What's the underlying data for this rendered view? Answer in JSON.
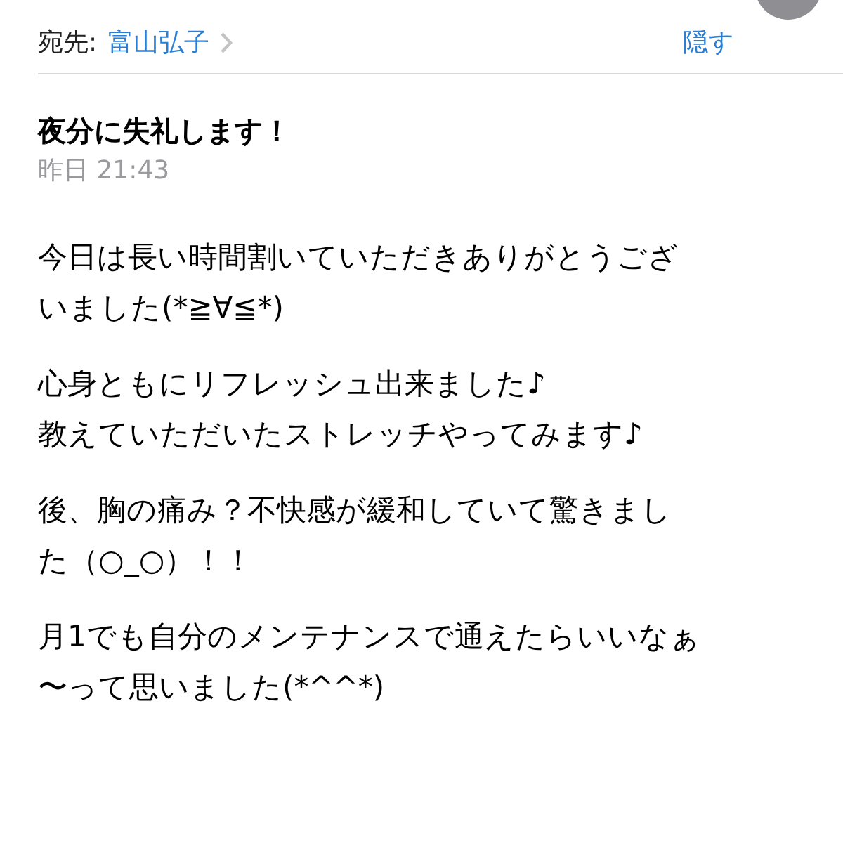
{
  "header": {
    "to_label": "宛先:",
    "recipient": "富山弘子",
    "hide_link": "隠す"
  },
  "message": {
    "subject": "夜分に失礼します！",
    "date": "昨日 21:43"
  },
  "body": [
    {
      "lines": [
        "今日は長い時間割いていただきありがとうござ",
        "いました(*≧∀≦*)"
      ]
    },
    {
      "lines": [
        "心身ともにリフレッシュ出来ました♪",
        "教えていただいたストレッチやってみます♪"
      ]
    },
    {
      "lines": [
        "後、胸の痛み？不快感が緩和していて驚きまし",
        "た（○_○）！！"
      ]
    },
    {
      "lines": [
        "月1でも自分のメンテナンスで通えたらいいなぁ",
        "〜って思いました(*^^*)"
      ]
    }
  ]
}
